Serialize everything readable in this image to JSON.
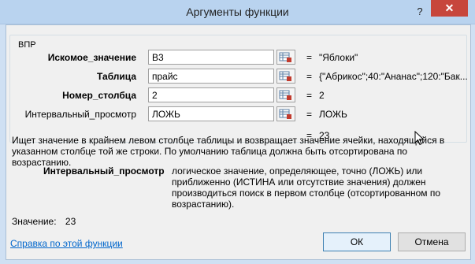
{
  "window": {
    "title": "Аргументы функции",
    "help_glyph": "?",
    "close_glyph": "✕"
  },
  "function_group": {
    "name": "ВПР",
    "args": [
      {
        "label": "Искомое_значение",
        "value": "B3",
        "result": "\"Яблоки\""
      },
      {
        "label": "Таблица",
        "value": "прайс",
        "result": "{\"Абрикос\";40:\"Ананас\";120:\"Бак..."
      },
      {
        "label": "Номер_столбца",
        "value": "2",
        "result": "2"
      },
      {
        "label": "Интервальный_просмотр",
        "value": "ЛОЖЬ",
        "result": "ЛОЖЬ"
      }
    ],
    "equals": "=",
    "formula_result": "23"
  },
  "description": "Ищет значение в крайнем левом столбце таблицы и возвращает значение ячейки, находящейся в указанном столбце той же строки. По умолчанию таблица должна быть отсортирована по возрастанию.",
  "param_help": {
    "name": "Интервальный_просмотр",
    "text": "логическое значение, определяющее, точно (ЛОЖЬ) или приближенно (ИСТИНА или отсутствие значения) должен производиться поиск в первом столбце (отсортированном по возрастанию)."
  },
  "result": {
    "label": "Значение:",
    "value": "23"
  },
  "footer": {
    "help_link": "Справка по этой функции",
    "ok_label": "ОК",
    "cancel_label": "Отмена"
  }
}
